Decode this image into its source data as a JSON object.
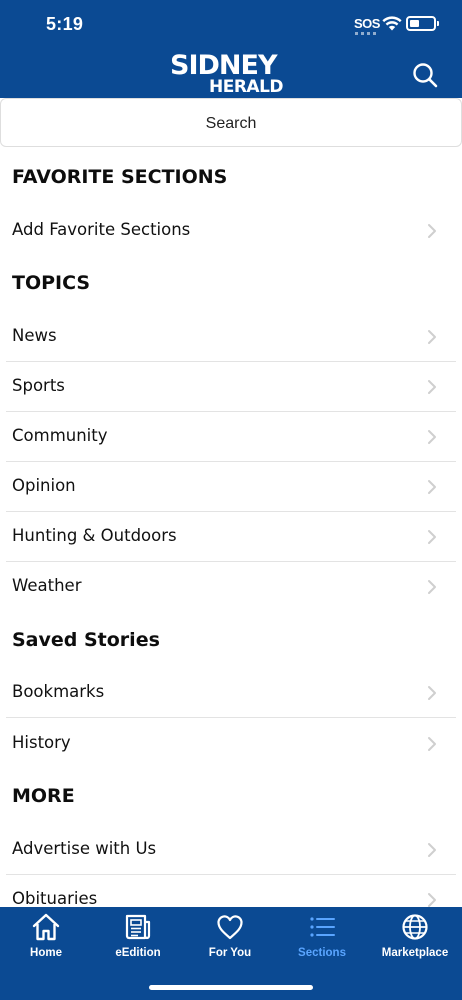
{
  "status_bar": {
    "time": "5:19",
    "carrier": "SOS",
    "icons": [
      "wifi-icon",
      "battery-icon"
    ]
  },
  "header": {
    "logo_line1": "SIDNEY",
    "logo_line2": "HERALD",
    "background_color": "#0b4a93",
    "search_icon": "search-icon"
  },
  "search": {
    "label": "Search"
  },
  "favorite_sections": {
    "title": "FAVORITE SECTIONS",
    "items": [
      {
        "label": "Add Favorite Sections"
      }
    ]
  },
  "topics": {
    "title": "TOPICS",
    "items": [
      {
        "label": "News"
      },
      {
        "label": "Sports"
      },
      {
        "label": "Community"
      },
      {
        "label": "Opinion"
      },
      {
        "label": "Hunting & Outdoors"
      },
      {
        "label": "Weather"
      }
    ]
  },
  "saved_stories": {
    "title": "Saved Stories",
    "items": [
      {
        "label": "Bookmarks"
      },
      {
        "label": "History"
      }
    ]
  },
  "more": {
    "title": "MORE",
    "items": [
      {
        "label": "Advertise with Us"
      },
      {
        "label": "Obituaries"
      }
    ]
  },
  "tabbar": {
    "active_color": "#5aa5ff",
    "tabs": [
      {
        "label": "Home",
        "icon": "home-icon",
        "active": false
      },
      {
        "label": "eEdition",
        "icon": "newspaper-icon",
        "active": false
      },
      {
        "label": "For You",
        "icon": "heart-icon",
        "active": false
      },
      {
        "label": "Sections",
        "icon": "list-icon",
        "active": true
      },
      {
        "label": "Marketplace",
        "icon": "globe-icon",
        "active": false
      }
    ]
  }
}
